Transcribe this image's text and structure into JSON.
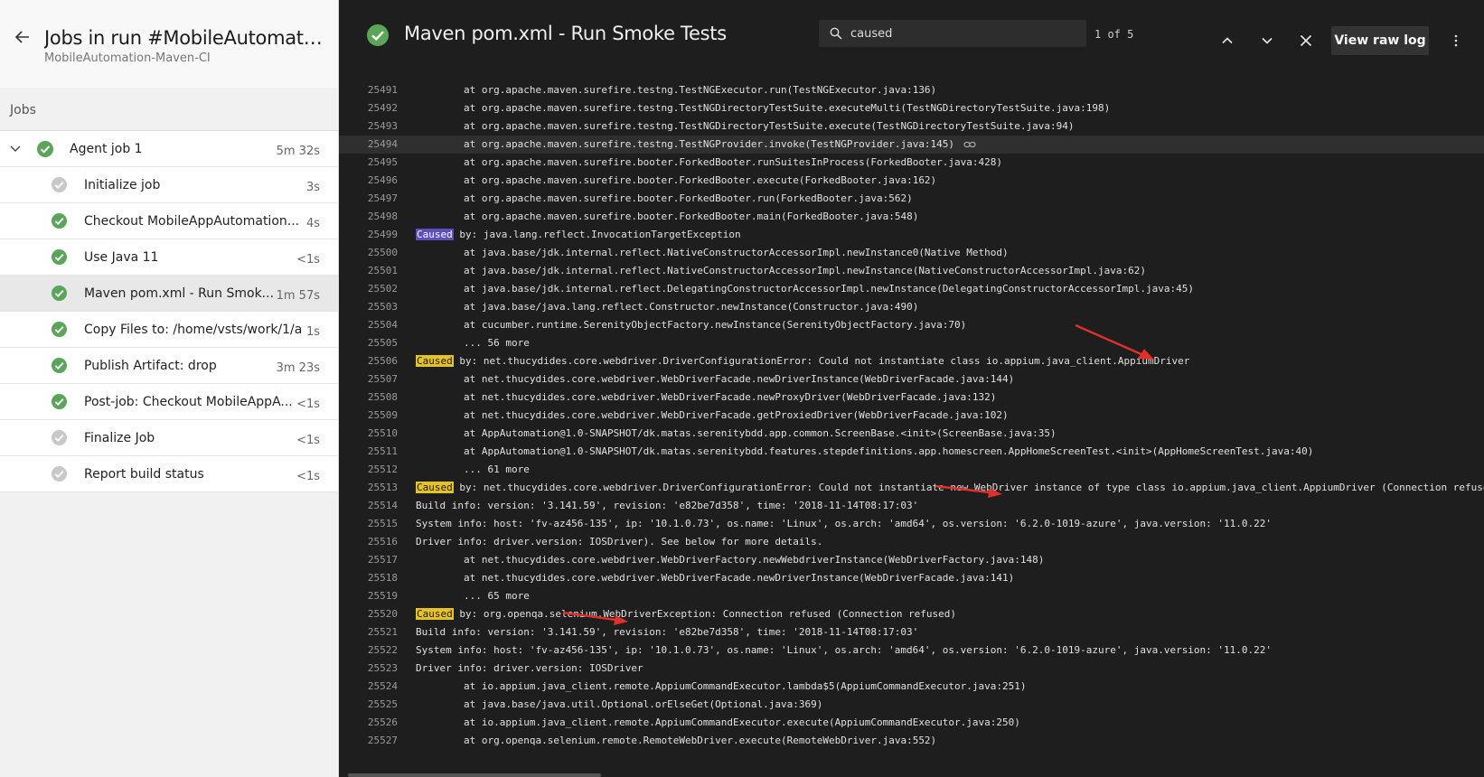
{
  "left_panel": {
    "run_title": "Jobs in run #MobileAutomatio...",
    "run_subtitle": "MobileAutomation-Maven-CI",
    "jobs_label": "Jobs",
    "agent": {
      "name": "Agent job 1",
      "duration": "5m 32s",
      "status": "succeeded"
    },
    "steps": [
      {
        "name": "Initialize job",
        "duration": "3s",
        "status": "skipped"
      },
      {
        "name": "Checkout MobileAppAutomation...",
        "duration": "4s",
        "status": "succeeded"
      },
      {
        "name": "Use Java 11",
        "duration": "<1s",
        "status": "succeeded"
      },
      {
        "name": "Maven pom.xml - Run Smok...",
        "duration": "1m 57s",
        "status": "succeeded",
        "selected": true
      },
      {
        "name": "Copy Files to: /home/vsts/work/1/a",
        "duration": "1s",
        "status": "succeeded"
      },
      {
        "name": "Publish Artifact: drop",
        "duration": "3m 23s",
        "status": "succeeded"
      },
      {
        "name": "Post-job: Checkout MobileAppA...",
        "duration": "<1s",
        "status": "succeeded"
      },
      {
        "name": "Finalize Job",
        "duration": "<1s",
        "status": "skipped"
      },
      {
        "name": "Report build status",
        "duration": "<1s",
        "status": "skipped"
      }
    ]
  },
  "log_header": {
    "title": "Maven pom.xml - Run Smoke Tests",
    "search_value": "caused",
    "match_count": "1 of 5",
    "raw_log_label": "View raw log"
  },
  "colors": {
    "success": "#5ba55b",
    "skipped": "#c8c8c8",
    "highlight": "#e6c229",
    "active_highlight": "#5b4fc0",
    "arrow": "#e0302b"
  },
  "log_lines": [
    {
      "n": "25491",
      "t": "at org.apache.maven.surefire.testng.TestNGExecutor.run(TestNGExecutor.java:136)",
      "indent": true
    },
    {
      "n": "25492",
      "t": "at org.apache.maven.surefire.testng.TestNGDirectoryTestSuite.executeMulti(TestNGDirectoryTestSuite.java:198)",
      "indent": true
    },
    {
      "n": "25493",
      "t": "at org.apache.maven.surefire.testng.TestNGDirectoryTestSuite.execute(TestNGDirectoryTestSuite.java:94)",
      "indent": true
    },
    {
      "n": "25494",
      "t": "at org.apache.maven.surefire.testng.TestNGProvider.invoke(TestNGProvider.java:145)",
      "indent": true,
      "hover": true
    },
    {
      "n": "25495",
      "t": "at org.apache.maven.surefire.booter.ForkedBooter.runSuitesInProcess(ForkedBooter.java:428)",
      "indent": true
    },
    {
      "n": "25496",
      "t": "at org.apache.maven.surefire.booter.ForkedBooter.execute(ForkedBooter.java:162)",
      "indent": true
    },
    {
      "n": "25497",
      "t": "at org.apache.maven.surefire.booter.ForkedBooter.run(ForkedBooter.java:562)",
      "indent": true
    },
    {
      "n": "25498",
      "t": "at org.apache.maven.surefire.booter.ForkedBooter.main(ForkedBooter.java:548)",
      "indent": true
    },
    {
      "n": "25499",
      "kw": "Caused",
      "t": " by: java.lang.reflect.InvocationTargetException",
      "active": true
    },
    {
      "n": "25500",
      "t": "at java.base/jdk.internal.reflect.NativeConstructorAccessorImpl.newInstance0(Native Method)",
      "indent": true
    },
    {
      "n": "25501",
      "t": "at java.base/jdk.internal.reflect.NativeConstructorAccessorImpl.newInstance(NativeConstructorAccessorImpl.java:62)",
      "indent": true
    },
    {
      "n": "25502",
      "t": "at java.base/jdk.internal.reflect.DelegatingConstructorAccessorImpl.newInstance(DelegatingConstructorAccessorImpl.java:45)",
      "indent": true
    },
    {
      "n": "25503",
      "t": "at java.base/java.lang.reflect.Constructor.newInstance(Constructor.java:490)",
      "indent": true
    },
    {
      "n": "25504",
      "t": "at cucumber.runtime.SerenityObjectFactory.newInstance(SerenityObjectFactory.java:70)",
      "indent": true
    },
    {
      "n": "25505",
      "t": "... 56 more",
      "indent": true
    },
    {
      "n": "25506",
      "kw": "Caused",
      "t": " by: net.thucydides.core.webdriver.DriverConfigurationError: Could not instantiate class io.appium.java_client.AppiumDriver"
    },
    {
      "n": "25507",
      "t": "at net.thucydides.core.webdriver.WebDriverFacade.newDriverInstance(WebDriverFacade.java:144)",
      "indent": true
    },
    {
      "n": "25508",
      "t": "at net.thucydides.core.webdriver.WebDriverFacade.newProxyDriver(WebDriverFacade.java:132)",
      "indent": true
    },
    {
      "n": "25509",
      "t": "at net.thucydides.core.webdriver.WebDriverFacade.getProxiedDriver(WebDriverFacade.java:102)",
      "indent": true
    },
    {
      "n": "25510",
      "t": "at AppAutomation@1.0-SNAPSHOT/dk.matas.serenitybdd.app.common.ScreenBase.<init>(ScreenBase.java:35)",
      "indent": true
    },
    {
      "n": "25511",
      "t": "at AppAutomation@1.0-SNAPSHOT/dk.matas.serenitybdd.features.stepdefinitions.app.homescreen.AppHomeScreenTest.<init>(AppHomeScreenTest.java:40)",
      "indent": true
    },
    {
      "n": "25512",
      "t": "... 61 more",
      "indent": true
    },
    {
      "n": "25513",
      "kw": "Caused",
      "t": " by: net.thucydides.core.webdriver.DriverConfigurationError: Could not instantiate new WebDriver instance of type class io.appium.java_client.AppiumDriver (Connection refuse"
    },
    {
      "n": "25514",
      "t": "Build info: version: '3.141.59', revision: 'e82be7d358', time: '2018-11-14T08:17:03'"
    },
    {
      "n": "25515",
      "t": "System info: host: 'fv-az456-135', ip: '10.1.0.73', os.name: 'Linux', os.arch: 'amd64', os.version: '6.2.0-1019-azure', java.version: '11.0.22'"
    },
    {
      "n": "25516",
      "t": "Driver info: driver.version: IOSDriver). See below for more details."
    },
    {
      "n": "25517",
      "t": "at net.thucydides.core.webdriver.WebDriverFactory.newWebdriverInstance(WebDriverFactory.java:148)",
      "indent": true
    },
    {
      "n": "25518",
      "t": "at net.thucydides.core.webdriver.WebDriverFacade.newDriverInstance(WebDriverFacade.java:141)",
      "indent": true
    },
    {
      "n": "25519",
      "t": "... 65 more",
      "indent": true
    },
    {
      "n": "25520",
      "kw": "Caused",
      "t": " by: org.openqa.selenium.WebDriverException: Connection refused (Connection refused)"
    },
    {
      "n": "25521",
      "t": "Build info: version: '3.141.59', revision: 'e82be7d358', time: '2018-11-14T08:17:03'"
    },
    {
      "n": "25522",
      "t": "System info: host: 'fv-az456-135', ip: '10.1.0.73', os.name: 'Linux', os.arch: 'amd64', os.version: '6.2.0-1019-azure', java.version: '11.0.22'"
    },
    {
      "n": "25523",
      "t": "Driver info: driver.version: IOSDriver"
    },
    {
      "n": "25524",
      "t": "at io.appium.java_client.remote.AppiumCommandExecutor.lambda$5(AppiumCommandExecutor.java:251)",
      "indent": true
    },
    {
      "n": "25525",
      "t": "at java.base/java.util.Optional.orElseGet(Optional.java:369)",
      "indent": true
    },
    {
      "n": "25526",
      "t": "at io.appium.java_client.remote.AppiumCommandExecutor.execute(AppiumCommandExecutor.java:250)",
      "indent": true
    },
    {
      "n": "25527",
      "t": "at org.openqa.selenium.remote.RemoteWebDriver.execute(RemoteWebDriver.java:552)",
      "indent": true
    }
  ]
}
